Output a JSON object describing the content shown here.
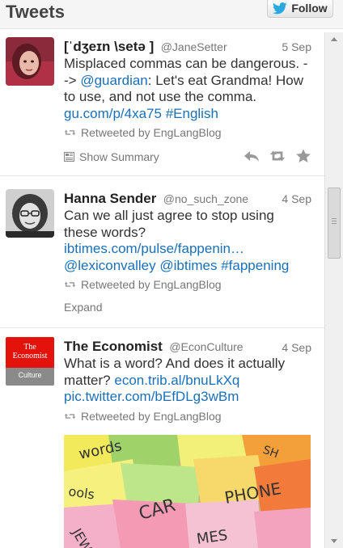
{
  "header": {
    "title": "Tweets",
    "follow_label": "Follow"
  },
  "tweets": [
    {
      "name": "[ˈdʒeɪn \\setə ]",
      "handle": "@JaneSetter",
      "date": "5 Sep",
      "text_plain": "Misplaced commas can be dangerous. -->",
      "link_guardian": "@guardian",
      "text_after": ": Let's eat Grandma! How to use, and not use the comma.",
      "link_url": "gu.com/p/4xa75",
      "link_hashtag": "#English",
      "retweeted_by": "Retweeted by EngLangBlog",
      "show_summary": "Show Summary"
    },
    {
      "name": "Hanna Sender",
      "handle": "@no_such_zone",
      "date": "4 Sep",
      "text_plain": "Can we all just agree to stop using these words?",
      "link_url": "ibtimes.com/pulse/fappenin…",
      "link_mention1": "@lexiconvalley",
      "link_mention2": "@ibtimes",
      "link_hashtag": "#fappening",
      "retweeted_by": "Retweeted by EngLangBlog",
      "expand": "Expand"
    },
    {
      "name": "The Economist",
      "handle": "@EconCulture",
      "date": "4 Sep",
      "avatar_brand": "The Economist",
      "avatar_section": "Culture",
      "text_plain": "What is a word? And does it actually matter?",
      "link_url": "econ.trib.al/bnuLkXq",
      "link_pic": "pic.twitter.com/bEfDLg3wBm",
      "retweeted_by": "Retweeted by EngLangBlog"
    }
  ],
  "colors": {
    "link": "#1b6fb7",
    "twitter_blue": "#2aa9e0",
    "economist_red": "#e3120b"
  }
}
